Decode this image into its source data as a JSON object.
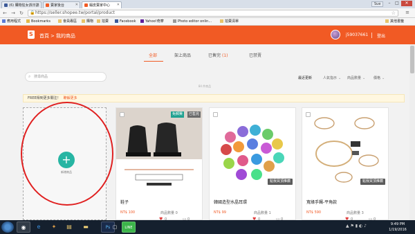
{
  "browser": {
    "tabs": [
      {
        "label": "(6) 購物狂女孩日誌",
        "active": false
      },
      {
        "label": "賣家後台",
        "active": false
      },
      {
        "label": "蝦皮賣家中心",
        "active": true
      }
    ],
    "user_button": "Sue",
    "url": "https://seller.shopee.tw/portal/product",
    "bookmarks": [
      "應用程式",
      "Bookmarks",
      "會員專區",
      "購物",
      "拍賣",
      "Facebook",
      "Yahoo!奇摩",
      "Photo editor onlin...",
      "拍賣清單",
      "其他書籤"
    ]
  },
  "header": {
    "breadcrumb_home": "首頁",
    "breadcrumb_sep": ">",
    "breadcrumb_current": "我的商品",
    "username": "j59037661",
    "logout": "登出"
  },
  "product_tabs": [
    {
      "label": "全部",
      "active": true
    },
    {
      "label": "架上商品",
      "active": false
    },
    {
      "label": "已售完",
      "count": "(1)",
      "active": false
    },
    {
      "label": "已禁賣",
      "active": false
    }
  ],
  "search_placeholder": "搜尋商品",
  "sort": {
    "latest": "最近更新",
    "popularity": "人氣指示",
    "quantity": "商品數量",
    "price": "價格"
  },
  "product_count": "84 件商品",
  "notice": {
    "text": "FREE得到更多關注！",
    "link": "瞭解更多"
  },
  "add_card": {
    "label": "新增商品"
  },
  "products": [
    {
      "name": "鞋子",
      "price": "NT$ 100",
      "stock": "商品數量 0",
      "likes": "0",
      "comments": "0",
      "badges": [
        "免郵費",
        "已售完"
      ],
      "boost": ""
    },
    {
      "name": "韓國造型水晶耳環",
      "price": "NT$ 99",
      "stock": "商品數量 1",
      "likes": "0",
      "comments": "0",
      "badges": [],
      "boost": "點我買頂推薦"
    },
    {
      "name": "寬緣手鐲-平角款",
      "price": "NT$ 590",
      "stock": "商品數量 3",
      "likes": "0",
      "comments": "0",
      "badges": [],
      "boost": "點我買頂推薦"
    }
  ],
  "taskbar": {
    "time": "9:49 PM",
    "date": "1/19/2016"
  },
  "colors": {
    "brand": "#f15a24",
    "add_button": "#27b5a3",
    "highlight_ring": "#e02020"
  }
}
